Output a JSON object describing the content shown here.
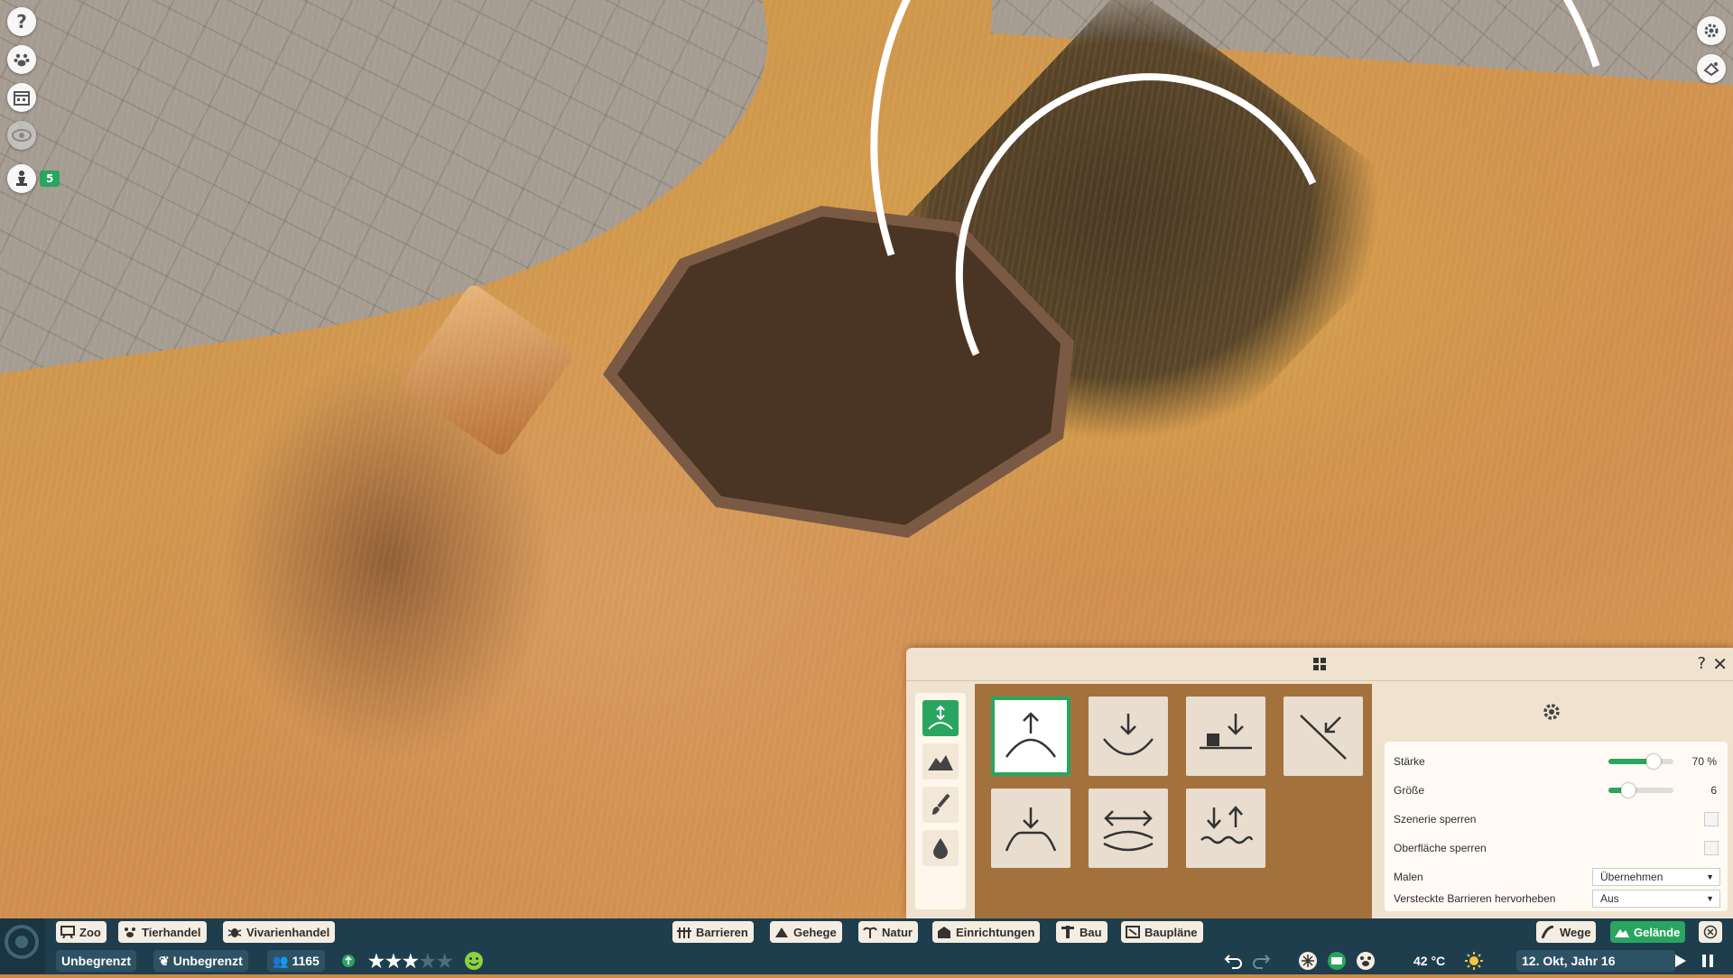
{
  "left_icons": [
    {
      "icon": "help-icon",
      "glyph": "?"
    },
    {
      "icon": "paw-icon",
      "glyph": "🐾"
    },
    {
      "icon": "calendar-icon",
      "glyph": "▦"
    },
    {
      "icon": "eye-icon",
      "glyph": "◉"
    }
  ],
  "ranking": {
    "icon": "chess-piece-icon",
    "count": "5"
  },
  "right_icons": [
    {
      "icon": "settings-gear-icon"
    },
    {
      "icon": "camera-icon"
    }
  ],
  "panel": {
    "header_icon": "grid-icon",
    "help": "?",
    "close": "✕",
    "categories": [
      {
        "icon": "raise-lower-icon",
        "active": true
      },
      {
        "icon": "mountain-icon",
        "active": false
      },
      {
        "icon": "paintbrush-icon",
        "active": false
      },
      {
        "icon": "water-drop-icon",
        "active": false
      }
    ],
    "tools": [
      {
        "icon": "raise-terrain-icon",
        "active": true
      },
      {
        "icon": "lower-terrain-icon",
        "active": false
      },
      {
        "icon": "lower-under-object-icon",
        "active": false
      },
      {
        "icon": "slope-icon",
        "active": false
      },
      {
        "icon": "flatten-icon",
        "active": false
      },
      {
        "icon": "smooth-icon",
        "active": false
      },
      {
        "icon": "roughen-icon",
        "active": false
      }
    ],
    "settings": {
      "strength": {
        "label": "Stärke",
        "value": "70 %",
        "level": 0.7
      },
      "size": {
        "label": "Größe",
        "value": "6",
        "level": 0.25
      },
      "lock_scenery": {
        "label": "Szenerie sperren",
        "checked": false
      },
      "lock_surface": {
        "label": "Oberfläche sperren",
        "checked": false
      },
      "paint": {
        "label": "Malen",
        "selected": "Übernehmen"
      },
      "highlight_barriers": {
        "label": "Versteckte Barrieren hervorheben",
        "selected": "Aus"
      }
    }
  },
  "bottom": {
    "left_tabs": [
      {
        "label": "Zoo",
        "icon": "zoo-icon"
      },
      {
        "label": "Tierhandel",
        "icon": "paw-icon"
      },
      {
        "label": "Vivarienhandel",
        "icon": "bug-icon"
      }
    ],
    "center_tabs": [
      {
        "label": "Barrieren",
        "icon": "fence-icon"
      },
      {
        "label": "Gehege",
        "icon": "habitat-icon"
      },
      {
        "label": "Natur",
        "icon": "palm-icon"
      },
      {
        "label": "Einrichtungen",
        "icon": "facility-icon"
      },
      {
        "label": "Bau",
        "icon": "construction-icon"
      },
      {
        "label": "Baupläne",
        "icon": "blueprint-icon"
      }
    ],
    "right_tabs": [
      {
        "label": "Wege",
        "icon": "path-icon",
        "active": false
      },
      {
        "label": "Gelände",
        "icon": "terrain-icon",
        "active": true
      }
    ],
    "money": "Unbegrenzt",
    "conservation": "Unbegrenzt",
    "guests": "1165",
    "rating_stars": 3,
    "rating_max": 5,
    "temperature": "42 °C",
    "date": "12. Okt, Jahr 16",
    "accent": "#2aa560"
  }
}
